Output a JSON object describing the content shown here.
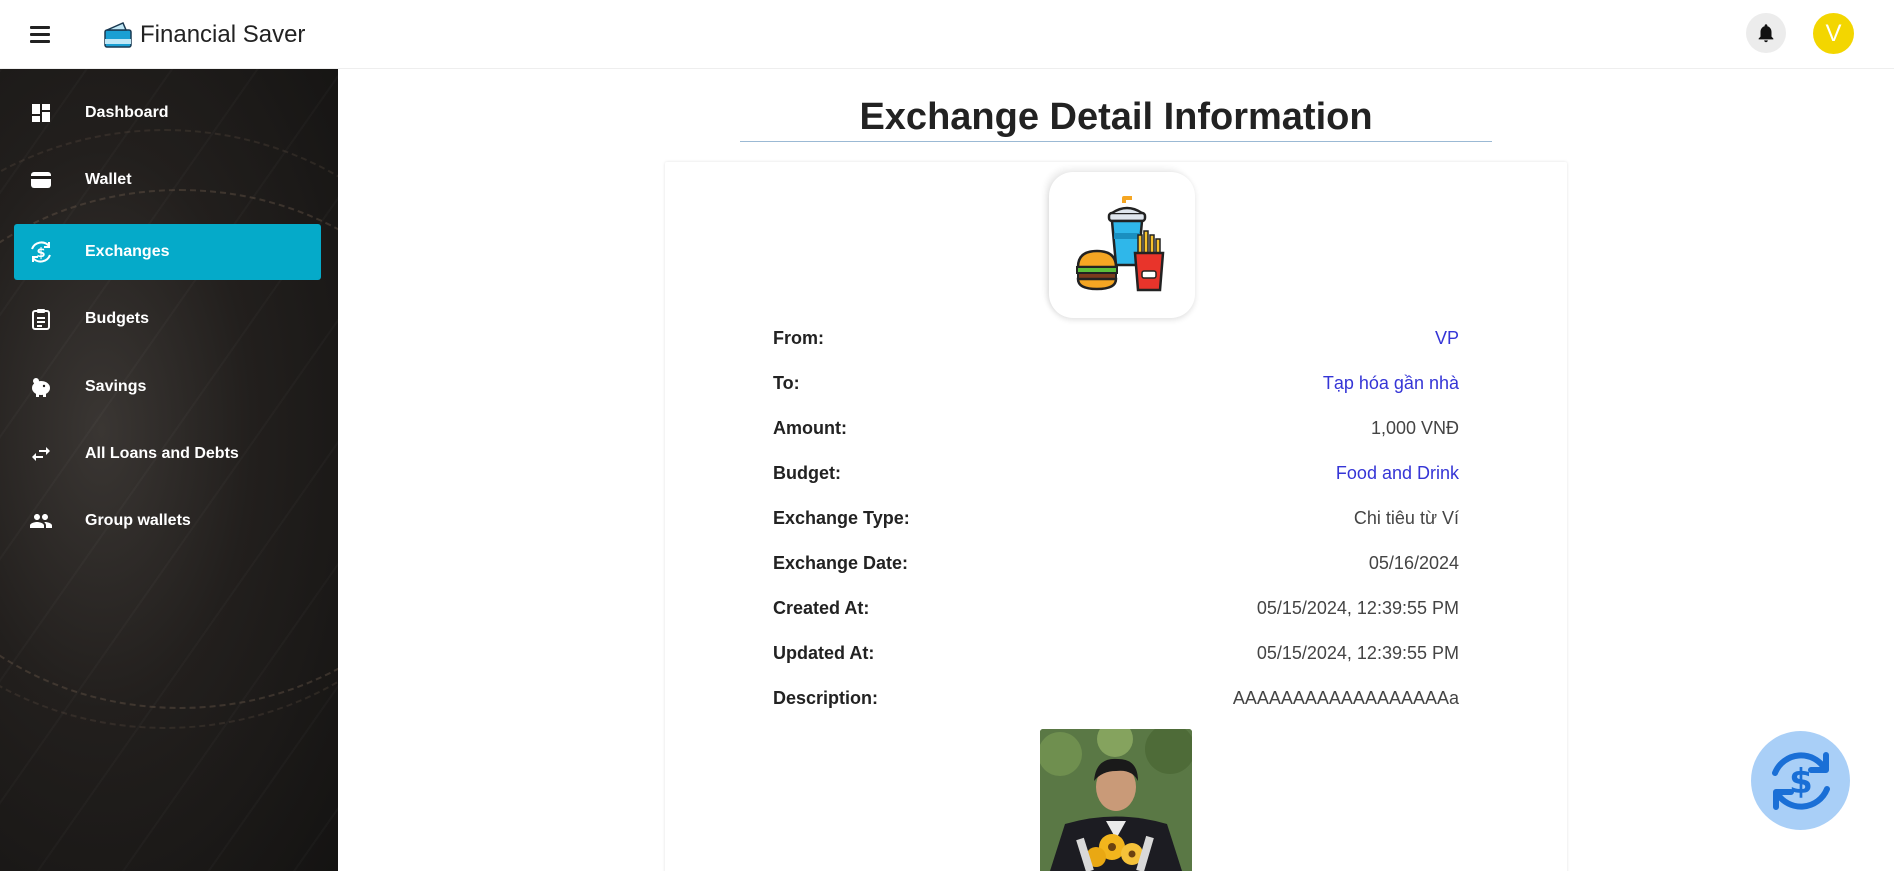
{
  "app": {
    "name": "Financial Saver",
    "avatar_initial": "V"
  },
  "sidebar": {
    "items": [
      {
        "label": "Dashboard",
        "icon": "dashboard-icon",
        "active": false
      },
      {
        "label": "Wallet",
        "icon": "wallet-icon",
        "active": false
      },
      {
        "label": "Exchanges",
        "icon": "exchange-icon",
        "active": true
      },
      {
        "label": "Budgets",
        "icon": "budget-icon",
        "active": false
      },
      {
        "label": "Savings",
        "icon": "piggy-bank-icon",
        "active": false
      },
      {
        "label": "All Loans and Debts",
        "icon": "swap-arrows-icon",
        "active": false
      },
      {
        "label": "Group wallets",
        "icon": "group-icon",
        "active": false
      }
    ]
  },
  "detail": {
    "title": "Exchange Detail Information",
    "category_icon": "food-and-drink-icon",
    "rows": [
      {
        "label": "From:",
        "value": "VP",
        "link": true
      },
      {
        "label": "To:",
        "value": "Tạp hóa gần nhà",
        "link": true
      },
      {
        "label": "Amount:",
        "value": "1,000 VNĐ",
        "link": false
      },
      {
        "label": "Budget:",
        "value": "Food and Drink",
        "link": true
      },
      {
        "label": "Exchange Type:",
        "value": "Chi tiêu từ Ví",
        "link": false
      },
      {
        "label": "Exchange Date:",
        "value": "05/16/2024",
        "link": false
      },
      {
        "label": "Created At:",
        "value": "05/15/2024, 12:39:55 PM",
        "link": false
      },
      {
        "label": "Updated At:",
        "value": "05/15/2024, 12:39:55 PM",
        "link": false
      },
      {
        "label": "Description:",
        "value": "AAAAAAAAAAAAAAAAAAa",
        "link": false
      }
    ]
  },
  "colors": {
    "accent": "#05aac9",
    "link": "#3535d6",
    "avatar": "#f3d600",
    "fab": "#a9cff7",
    "fab_icon": "#1a6fd6"
  }
}
